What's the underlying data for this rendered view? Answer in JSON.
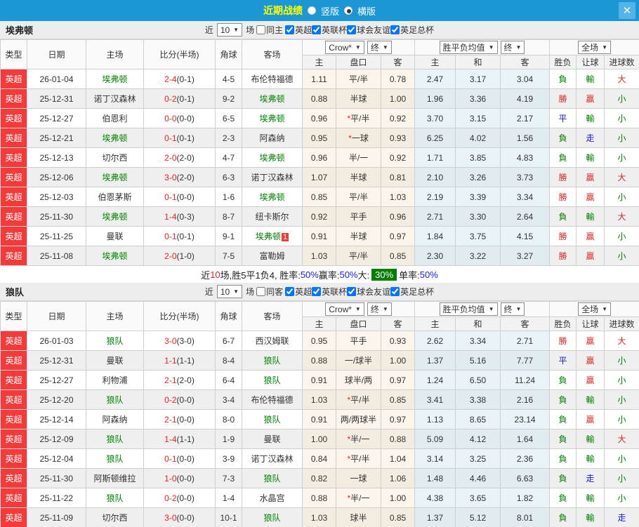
{
  "titlebar": {
    "title": "近期战绩",
    "radios": [
      {
        "label": "竖版",
        "selected": false
      },
      {
        "label": "横版",
        "selected": true
      }
    ],
    "close_icon": "✕"
  },
  "columns": {
    "type": "类型",
    "date": "日期",
    "home": "主场",
    "score": "比分(半场)",
    "corner": "角球",
    "away": "客场",
    "crow_select": "Crow*",
    "final_select": "终",
    "odds_home": "主",
    "handicap": "盘口",
    "odds_away": "客",
    "mean_select": "胜平负均值",
    "mean_home": "主",
    "mean_draw": "和",
    "mean_away": "客",
    "fullmatch_select": "全场",
    "res_wdl": "胜负",
    "res_handicap": "让球",
    "res_goals": "进球数"
  },
  "result_colors": {
    "勝": "c-red",
    "贏": "c-red",
    "大": "c-red",
    "平": "c-blue",
    "走": "c-blue",
    "負": "c-green",
    "輸": "c-green",
    "小": "c-green"
  },
  "sections": [
    {
      "team": "埃弗顿",
      "filter": {
        "near_label": "近",
        "count": "10",
        "matches_label": "场",
        "same_label": "同主",
        "same_checked": false,
        "leagues": [
          {
            "label": "英超",
            "checked": true
          },
          {
            "label": "英联杯",
            "checked": true
          },
          {
            "label": "球会友谊",
            "checked": true
          },
          {
            "label": "英足总杯",
            "checked": true
          }
        ]
      },
      "rows": [
        {
          "type": "英超",
          "date": "26-01-04",
          "home": "埃弗顿",
          "home_green": true,
          "ft": "2-4",
          "ht": "(0-1)",
          "corners": "4-5",
          "away": "布伦特福德",
          "away_green": false,
          "odds_home": "1.11",
          "handicap": "平/半",
          "odds_away": "0.78",
          "mean_home": "2.47",
          "mean_draw": "3.17",
          "mean_away": "3.04",
          "res_wdl": "負",
          "res_handicap": "輸",
          "res_goals": "大"
        },
        {
          "type": "英超",
          "date": "25-12-31",
          "home": "诺丁汉森林",
          "home_green": false,
          "ft": "0-2",
          "ht": "(0-1)",
          "corners": "9-2",
          "away": "埃弗顿",
          "away_green": true,
          "odds_home": "0.88",
          "handicap": "半球",
          "odds_away": "1.00",
          "mean_home": "1.96",
          "mean_draw": "3.36",
          "mean_away": "4.19",
          "res_wdl": "勝",
          "res_handicap": "贏",
          "res_goals": "小"
        },
        {
          "type": "英超",
          "date": "25-12-27",
          "home": "伯恩利",
          "home_green": false,
          "ft": "0-0",
          "ht": "(0-0)",
          "corners": "6-5",
          "away": "埃弗顿",
          "away_green": true,
          "odds_home": "0.96",
          "handicap": "*平/半",
          "odds_away": "0.92",
          "mean_home": "3.70",
          "mean_draw": "3.15",
          "mean_away": "2.17",
          "res_wdl": "平",
          "res_handicap": "輸",
          "res_goals": "小"
        },
        {
          "type": "英超",
          "date": "25-12-21",
          "home": "埃弗顿",
          "home_green": true,
          "ft": "0-1",
          "ht": "(0-1)",
          "corners": "2-3",
          "away": "阿森纳",
          "away_green": false,
          "odds_home": "0.95",
          "handicap": "*一球",
          "odds_away": "0.93",
          "mean_home": "6.25",
          "mean_draw": "4.02",
          "mean_away": "1.56",
          "res_wdl": "負",
          "res_handicap": "走",
          "res_goals": "小"
        },
        {
          "type": "英超",
          "date": "25-12-13",
          "home": "切尔西",
          "home_green": false,
          "ft": "2-0",
          "ht": "(2-0)",
          "corners": "4-7",
          "away": "埃弗顿",
          "away_green": true,
          "odds_home": "0.96",
          "handicap": "半/一",
          "odds_away": "0.92",
          "mean_home": "1.71",
          "mean_draw": "3.85",
          "mean_away": "4.83",
          "res_wdl": "負",
          "res_handicap": "輸",
          "res_goals": "小"
        },
        {
          "type": "英超",
          "date": "25-12-06",
          "home": "埃弗顿",
          "home_green": true,
          "ft": "3-0",
          "ht": "(2-0)",
          "corners": "6-3",
          "away": "诺丁汉森林",
          "away_green": false,
          "odds_home": "1.07",
          "handicap": "半球",
          "odds_away": "0.81",
          "mean_home": "2.10",
          "mean_draw": "3.26",
          "mean_away": "3.73",
          "res_wdl": "勝",
          "res_handicap": "贏",
          "res_goals": "大"
        },
        {
          "type": "英超",
          "date": "25-12-03",
          "home": "伯恩茅斯",
          "home_green": false,
          "ft": "0-1",
          "ht": "(0-0)",
          "corners": "1-6",
          "away": "埃弗顿",
          "away_green": true,
          "odds_home": "0.85",
          "handicap": "平/半",
          "odds_away": "1.03",
          "mean_home": "2.19",
          "mean_draw": "3.39",
          "mean_away": "3.34",
          "res_wdl": "勝",
          "res_handicap": "贏",
          "res_goals": "小"
        },
        {
          "type": "英超",
          "date": "25-11-30",
          "home": "埃弗顿",
          "home_green": true,
          "ft": "1-4",
          "ht": "(0-3)",
          "corners": "8-7",
          "away": "纽卡斯尔",
          "away_green": false,
          "odds_home": "0.92",
          "handicap": "平手",
          "odds_away": "0.96",
          "mean_home": "2.71",
          "mean_draw": "3.30",
          "mean_away": "2.64",
          "res_wdl": "負",
          "res_handicap": "輸",
          "res_goals": "大"
        },
        {
          "type": "英超",
          "date": "25-11-25",
          "home": "曼联",
          "home_green": false,
          "ft": "0-1",
          "ht": "(0-1)",
          "corners": "9-1",
          "away": "埃弗顿",
          "away_green": true,
          "away_badge": "1",
          "odds_home": "0.91",
          "handicap": "半球",
          "odds_away": "0.97",
          "mean_home": "1.84",
          "mean_draw": "3.75",
          "mean_away": "4.15",
          "res_wdl": "勝",
          "res_handicap": "贏",
          "res_goals": "小"
        },
        {
          "type": "英超",
          "date": "25-11-08",
          "home": "埃弗顿",
          "home_green": true,
          "ft": "2-0",
          "ht": "(1-0)",
          "corners": "7-5",
          "away": "富勒姆",
          "away_green": false,
          "odds_home": "1.03",
          "handicap": "平/半",
          "odds_away": "0.85",
          "mean_home": "2.30",
          "mean_draw": "3.22",
          "mean_away": "3.27",
          "res_wdl": "勝",
          "res_handicap": "贏",
          "res_goals": "小"
        }
      ],
      "summary": {
        "segments": [
          {
            "t": "近",
            "c": "k"
          },
          {
            "t": "10",
            "c": "r"
          },
          {
            "t": "场,胜5平1负4, 胜率:",
            "c": "k"
          },
          {
            "t": "50%",
            "c": "b"
          },
          {
            "t": " 赢率:",
            "c": "k"
          },
          {
            "t": "50%",
            "c": "b"
          },
          {
            "t": " 大:",
            "c": "k"
          },
          {
            "t": "30%",
            "c": "gbg"
          },
          {
            "t": " 单率:",
            "c": "k"
          },
          {
            "t": "50%",
            "c": "b"
          }
        ]
      }
    },
    {
      "team": "狼队",
      "filter": {
        "near_label": "近",
        "count": "10",
        "matches_label": "场",
        "same_label": "同客",
        "same_checked": false,
        "leagues": [
          {
            "label": "英超",
            "checked": true
          },
          {
            "label": "英联杯",
            "checked": true
          },
          {
            "label": "球会友谊",
            "checked": true
          },
          {
            "label": "英足总杯",
            "checked": true
          }
        ]
      },
      "rows": [
        {
          "type": "英超",
          "date": "26-01-03",
          "home": "狼队",
          "home_green": true,
          "ft": "3-0",
          "ht": "(3-0)",
          "corners": "6-7",
          "away": "西汉姆联",
          "away_green": false,
          "odds_home": "0.95",
          "handicap": "平手",
          "odds_away": "0.93",
          "mean_home": "2.62",
          "mean_draw": "3.34",
          "mean_away": "2.71",
          "res_wdl": "勝",
          "res_handicap": "贏",
          "res_goals": "大"
        },
        {
          "type": "英超",
          "date": "25-12-31",
          "home": "曼联",
          "home_green": false,
          "ft": "1-1",
          "ht": "(1-1)",
          "corners": "8-4",
          "away": "狼队",
          "away_green": true,
          "odds_home": "0.88",
          "handicap": "一/球半",
          "odds_away": "1.00",
          "mean_home": "1.37",
          "mean_draw": "5.16",
          "mean_away": "7.77",
          "res_wdl": "平",
          "res_handicap": "贏",
          "res_goals": "小"
        },
        {
          "type": "英超",
          "date": "25-12-27",
          "home": "利物浦",
          "home_green": false,
          "ft": "2-1",
          "ht": "(2-0)",
          "corners": "6-4",
          "away": "狼队",
          "away_green": true,
          "odds_home": "0.91",
          "handicap": "球半/两",
          "odds_away": "0.97",
          "mean_home": "1.24",
          "mean_draw": "6.50",
          "mean_away": "11.24",
          "res_wdl": "負",
          "res_handicap": "贏",
          "res_goals": "小"
        },
        {
          "type": "英超",
          "date": "25-12-20",
          "home": "狼队",
          "home_green": true,
          "ft": "0-2",
          "ht": "(0-0)",
          "corners": "3-4",
          "away": "布伦特福德",
          "away_green": false,
          "odds_home": "1.03",
          "handicap": "*平/半",
          "odds_away": "0.85",
          "mean_home": "3.41",
          "mean_draw": "3.38",
          "mean_away": "2.16",
          "res_wdl": "負",
          "res_handicap": "輸",
          "res_goals": "小"
        },
        {
          "type": "英超",
          "date": "25-12-14",
          "home": "阿森纳",
          "home_green": false,
          "ft": "2-1",
          "ht": "(0-0)",
          "corners": "8-0",
          "away": "狼队",
          "away_green": true,
          "odds_home": "0.91",
          "handicap": "两/两球半",
          "odds_away": "0.97",
          "mean_home": "1.13",
          "mean_draw": "8.65",
          "mean_away": "23.14",
          "res_wdl": "負",
          "res_handicap": "贏",
          "res_goals": "小"
        },
        {
          "type": "英超",
          "date": "25-12-09",
          "home": "狼队",
          "home_green": true,
          "ft": "1-4",
          "ht": "(1-1)",
          "corners": "1-9",
          "away": "曼联",
          "away_green": false,
          "odds_home": "1.00",
          "handicap": "*半/一",
          "odds_away": "0.88",
          "mean_home": "5.09",
          "mean_draw": "4.12",
          "mean_away": "1.64",
          "res_wdl": "負",
          "res_handicap": "輸",
          "res_goals": "大"
        },
        {
          "type": "英超",
          "date": "25-12-04",
          "home": "狼队",
          "home_green": true,
          "ft": "0-1",
          "ht": "(0-0)",
          "corners": "3-9",
          "away": "诺丁汉森林",
          "away_green": false,
          "odds_home": "0.84",
          "handicap": "*平/半",
          "odds_away": "1.04",
          "mean_home": "3.14",
          "mean_draw": "3.25",
          "mean_away": "2.36",
          "res_wdl": "負",
          "res_handicap": "輸",
          "res_goals": "小"
        },
        {
          "type": "英超",
          "date": "25-11-30",
          "home": "阿斯顿维拉",
          "home_green": false,
          "ft": "1-0",
          "ht": "(0-0)",
          "corners": "7-3",
          "away": "狼队",
          "away_green": true,
          "odds_home": "0.82",
          "handicap": "一球",
          "odds_away": "1.06",
          "mean_home": "1.48",
          "mean_draw": "4.46",
          "mean_away": "6.63",
          "res_wdl": "負",
          "res_handicap": "走",
          "res_goals": "小"
        },
        {
          "type": "英超",
          "date": "25-11-22",
          "home": "狼队",
          "home_green": true,
          "ft": "0-2",
          "ht": "(0-0)",
          "corners": "1-4",
          "away": "水晶宫",
          "away_green": false,
          "odds_home": "0.88",
          "handicap": "*半/一",
          "odds_away": "1.00",
          "mean_home": "4.38",
          "mean_draw": "3.65",
          "mean_away": "1.82",
          "res_wdl": "負",
          "res_handicap": "輸",
          "res_goals": "小"
        },
        {
          "type": "英超",
          "date": "25-11-09",
          "home": "切尔西",
          "home_green": false,
          "ft": "3-0",
          "ht": "(0-0)",
          "corners": "10-1",
          "away": "狼队",
          "away_green": true,
          "odds_home": "1.03",
          "handicap": "球半",
          "odds_away": "0.85",
          "mean_home": "1.37",
          "mean_draw": "5.12",
          "mean_away": "8.01",
          "res_wdl": "負",
          "res_handicap": "輸",
          "res_goals": "走"
        }
      ]
    }
  ]
}
